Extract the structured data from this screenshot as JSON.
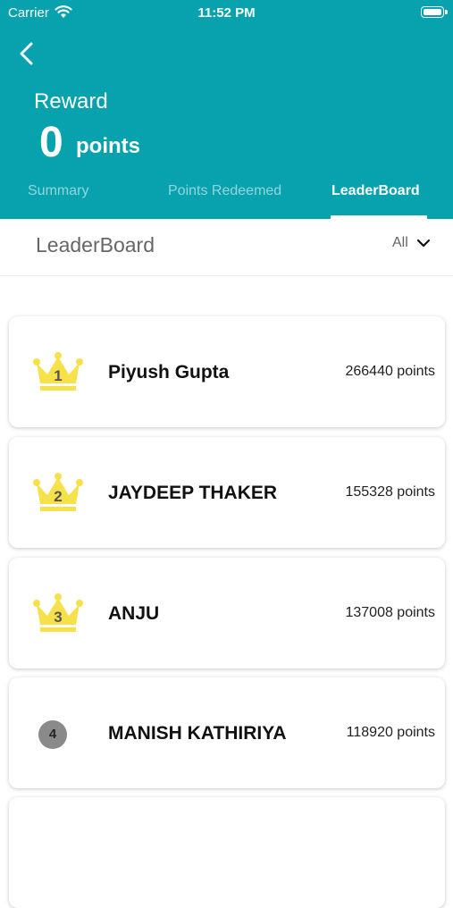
{
  "status_bar": {
    "carrier": "Carrier",
    "time": "11:52 PM"
  },
  "header": {
    "title": "Reward",
    "points_value": "0",
    "points_unit": "points"
  },
  "tabs": [
    {
      "label": "Summary",
      "active": false
    },
    {
      "label": "Points Redeemed",
      "active": false
    },
    {
      "label": "LeaderBoard",
      "active": true
    }
  ],
  "subheader": {
    "title": "LeaderBoard",
    "filter": "All"
  },
  "leaderboard": [
    {
      "rank": "1",
      "name": "Piyush Gupta",
      "points": "266440 points",
      "badge": "crown"
    },
    {
      "rank": "2",
      "name": "JAYDEEP THAKER",
      "points": "155328 points",
      "badge": "crown"
    },
    {
      "rank": "3",
      "name": "ANJU",
      "points": "137008 points",
      "badge": "crown"
    },
    {
      "rank": "4",
      "name": "MANISH KATHIRIYA",
      "points": "118920 points",
      "badge": "circle"
    }
  ],
  "colors": {
    "header_bg": "#08a2af",
    "crown": "#f7e14a",
    "rank_circle": "#8a8a8a"
  }
}
